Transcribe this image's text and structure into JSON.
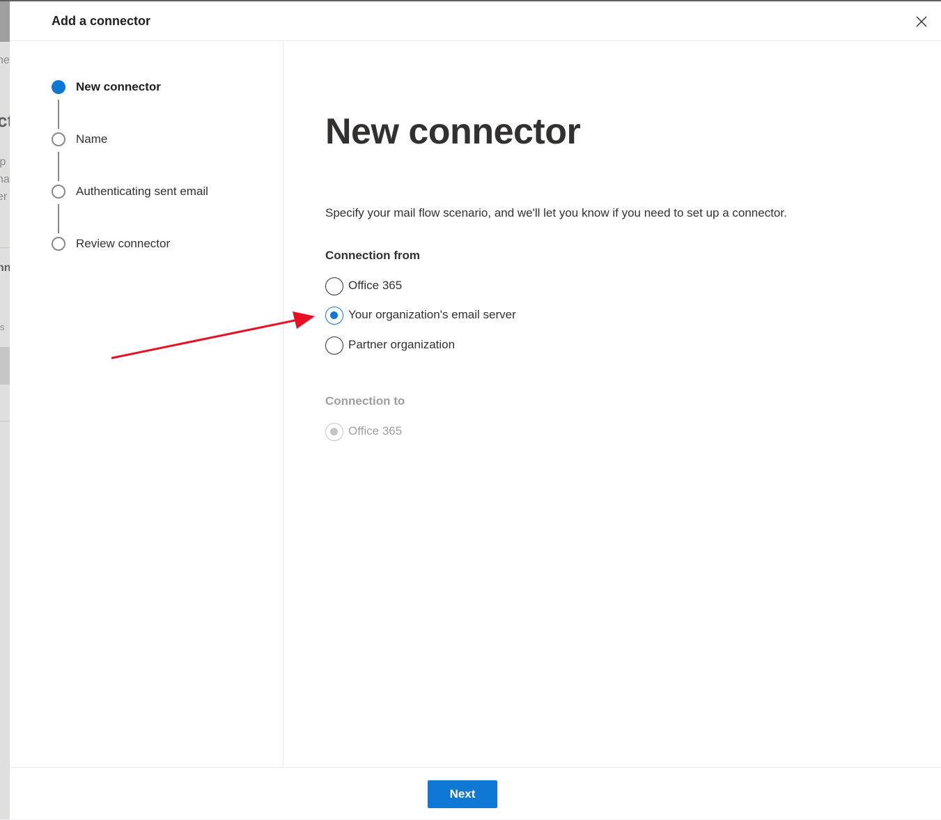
{
  "dialog": {
    "title": "Add a connector",
    "close_icon": "close-icon"
  },
  "background_fragments": [
    "ne",
    "ct",
    "lp",
    "nat",
    "er",
    "nn",
    "s"
  ],
  "stepper": {
    "steps": [
      {
        "label": "New connector",
        "state": "current"
      },
      {
        "label": "Name",
        "state": "upcoming"
      },
      {
        "label": "Authenticating sent email",
        "state": "upcoming"
      },
      {
        "label": "Review connector",
        "state": "upcoming"
      }
    ]
  },
  "main": {
    "title": "New connector",
    "description": "Specify your mail flow scenario, and we'll let you know if you need to set up a connector.",
    "connection_from": {
      "label": "Connection from",
      "options": [
        {
          "label": "Office 365",
          "checked": false
        },
        {
          "label": "Your organization's email server",
          "checked": true
        },
        {
          "label": "Partner organization",
          "checked": false
        }
      ]
    },
    "connection_to": {
      "label": "Connection to",
      "options": [
        {
          "label": "Office 365",
          "checked": true,
          "disabled": true
        }
      ]
    }
  },
  "footer": {
    "next_label": "Next"
  },
  "colors": {
    "accent": "#0f78d4",
    "annotation_arrow": "#e81123"
  }
}
